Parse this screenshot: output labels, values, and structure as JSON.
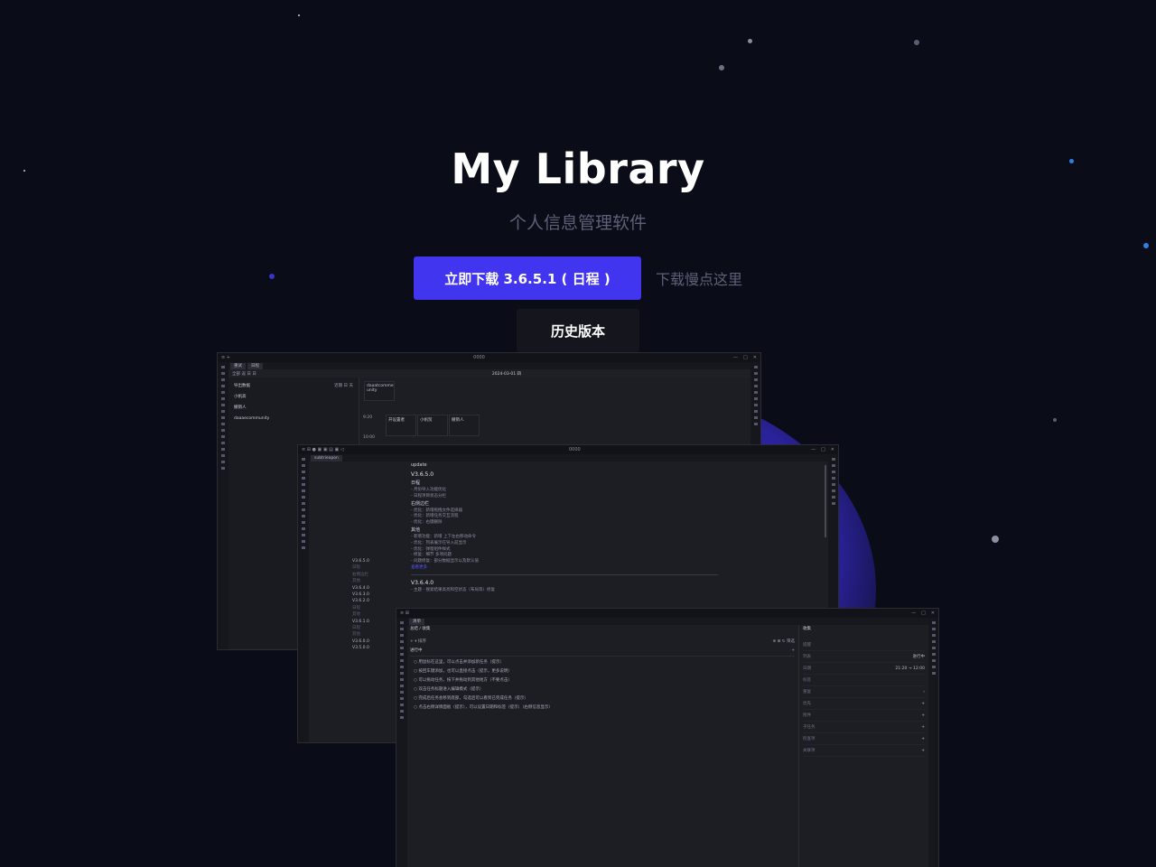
{
  "hero": {
    "title": "My Library",
    "subtitle": "个人信息管理软件",
    "download_label": "立即下载 3.6.5.1 ( 日程 )",
    "slow_download_label": "下载慢点这里",
    "history_label": "历史版本"
  },
  "colors": {
    "background": "#0a0c18",
    "accent": "#4135f0",
    "muted_text": "#5d6077",
    "glow": "#3b32d8"
  },
  "screenshots": {
    "back": {
      "title": "0000",
      "tabs": [
        "重试",
        "日程"
      ],
      "toolbar": [
        "全部",
        "返",
        "日",
        "日"
      ],
      "date": "2024-03-01 四",
      "list_header": "导出数据",
      "list_header_right": "近期 日 天",
      "list_items": [
        "小帆高",
        "撤销人",
        "daaaecommunity"
      ],
      "event_top": "daaatcomme unity",
      "times": [
        "9:20",
        "10:00"
      ],
      "events": [
        "开设置者",
        "小帆贸",
        "撤销人"
      ]
    },
    "middle": {
      "title": "0000",
      "tab": "subtrieapon",
      "header": "update",
      "version_1": "V3.6.5.0",
      "section_1": "日程",
      "section_1_items": [
        "- 月份导入功能优化",
        "- 日程项目状态分栏"
      ],
      "section_2": "右侧边栏",
      "section_2_items": [
        "- 优化：新增拖拽文件选择器",
        "- 优化：新增任务交互流程",
        "- 优化：右键删除"
      ],
      "section_3": "其他",
      "section_3_items": [
        "- 新增功能：新增 上下左右移动命令",
        "- 优化：列表展示在导入前显示",
        "- 优化：弹窗组件样式",
        "- 修复：细节 多项问题",
        "- 问题修复：部分数据显示以及默认值"
      ],
      "more_link": "查看更多",
      "version_2": "V3.6.4.0",
      "version_2_item": "- 主题 - 搜索结果高亮和空状态（布局等）修复",
      "version_list": [
        "V3.6.5.0",
        "日程",
        "右侧边栏",
        "其他",
        "V3.6.4.0",
        "V3.6.3.0",
        "V3.6.2.0",
        "日程",
        "其他",
        "V3.6.1.0",
        "日程",
        "其他",
        "V3.6.0.0",
        "V3.5.0.0"
      ]
    },
    "front": {
      "title": "",
      "tab": "清单",
      "breadcrumb": "总结 / 收集",
      "toolbar_left": "+  ▾ 排序",
      "toolbar_right": [
        "⊕",
        "⊞",
        "↻ 筛选"
      ],
      "group_title": "进行中",
      "tasks": [
        "○  用鼠标在这里，可以点击并添加新任务（提示）",
        "○  按回车键添加，也可以直接点击（提示，更多说明）",
        "○  可以拖动任务，按下并拖动到其他地方（不要点击）",
        "○  双击任务标题进入编辑模式（提示）",
        "○  完成后任务会移到底部，勾选后可以看到已完成任务（提示）",
        "○  点击右侧详情面板（提示），可以设置日期和标签（提示）（右侧信息显示）"
      ],
      "panel_title": "收集",
      "panel_rows": [
        {
          "label": "提醒",
          "value": ""
        },
        {
          "label": "列表",
          "value": "进行中"
        },
        {
          "label": "日期",
          "value": "21:20 → 12:00"
        },
        {
          "label": "标签",
          "value": ""
        },
        {
          "label": "重复",
          "value": "›"
        },
        {
          "label": "优先",
          "value": "+"
        },
        {
          "label": "附件",
          "value": "+"
        },
        {
          "label": "子任务",
          "value": "+"
        },
        {
          "label": "检查项",
          "value": "+"
        },
        {
          "label": "关联项",
          "value": "+"
        }
      ]
    }
  }
}
